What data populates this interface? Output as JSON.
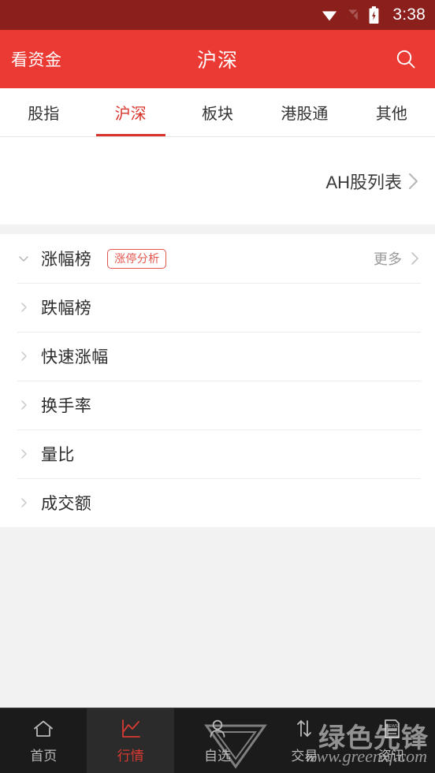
{
  "status_bar": {
    "time": "3:38",
    "icons": [
      "wifi-icon",
      "signal-icon",
      "battery-charging-icon"
    ],
    "background": "#8b1f1c"
  },
  "appbar": {
    "left_action": "看资金",
    "title": "沪深",
    "search_icon": "search-icon",
    "background": "#ea3a33"
  },
  "tabs": {
    "active_index": 1,
    "items": [
      {
        "label": "股指"
      },
      {
        "label": "沪深"
      },
      {
        "label": "板块"
      },
      {
        "label": "港股通"
      },
      {
        "label": "其他"
      }
    ],
    "active_color": "#d9342b"
  },
  "ah_panel": {
    "label": "AH股列表",
    "chevron": "chevron-right-icon"
  },
  "list": {
    "rows": [
      {
        "label": "涨幅榜",
        "chevron": "chevron-down-icon",
        "badge": "涨停分析",
        "more_label": "更多",
        "more_chevron": "chevron-right-icon"
      },
      {
        "label": "跌幅榜",
        "chevron": "chevron-right-icon"
      },
      {
        "label": "快速涨幅",
        "chevron": "chevron-right-icon"
      },
      {
        "label": "换手率",
        "chevron": "chevron-right-icon"
      },
      {
        "label": "量比",
        "chevron": "chevron-right-icon"
      },
      {
        "label": "成交额",
        "chevron": "chevron-right-icon"
      }
    ],
    "badge_color": "#e2554c"
  },
  "bottom_nav": {
    "active_index": 1,
    "items": [
      {
        "label": "首页",
        "icon": "home-icon"
      },
      {
        "label": "行情",
        "icon": "chart-line-icon"
      },
      {
        "label": "自选",
        "icon": "person-icon"
      },
      {
        "label": "交易",
        "icon": "transfer-arrows-icon"
      },
      {
        "label": "资讯",
        "icon": "news-icon"
      }
    ],
    "active_color": "#d83a32",
    "background": "#1b1b1b"
  },
  "watermark": {
    "brand": "绿色先锋",
    "url": "www.greenxf.com"
  }
}
